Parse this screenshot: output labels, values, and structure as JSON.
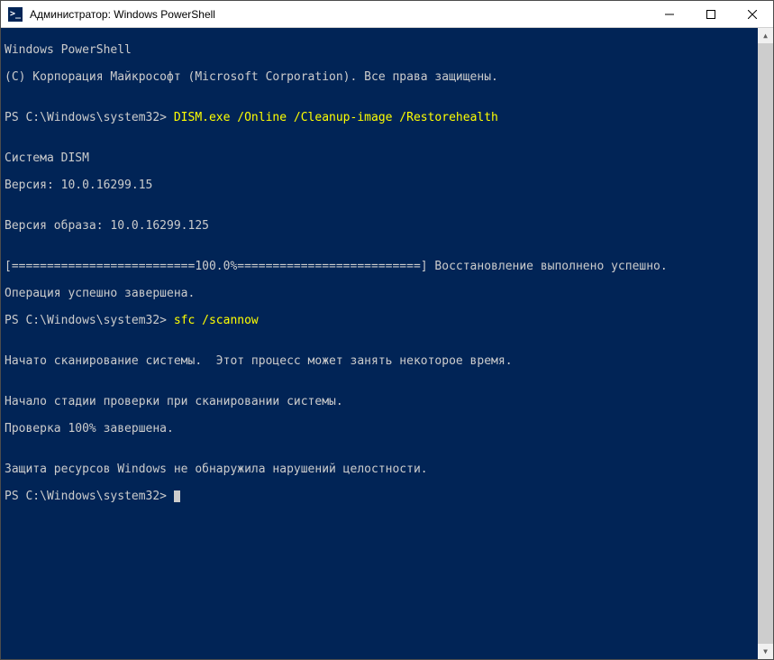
{
  "window": {
    "title": "Администратор: Windows PowerShell",
    "icon_glyph": ">_"
  },
  "terminal": {
    "header1": "Windows PowerShell",
    "header2": "(C) Корпорация Майкрософт (Microsoft Corporation). Все права защищены.",
    "prompt1": "PS C:\\Windows\\system32> ",
    "cmd1": "DISM.exe /Online /Cleanup-image /Restorehealth",
    "blank": "",
    "dism_label": "Система DISM",
    "dism_version": "Версия: 10.0.16299.15",
    "image_version": "Версия образа: 10.0.16299.125",
    "progress": "[==========================100.0%==========================] Восстановление выполнено успешно.",
    "op_done": "Операция успешно завершена.",
    "prompt2": "PS C:\\Windows\\system32> ",
    "cmd2": "sfc /scannow",
    "scan_start": "Начато сканирование системы.  Этот процесс может занять некоторое время.",
    "scan_stage": "Начало стадии проверки при сканировании системы.",
    "scan_pct": "Проверка 100% завершена.",
    "sfc_result": "Защита ресурсов Windows не обнаружила нарушений целостности.",
    "prompt3": "PS C:\\Windows\\system32> "
  }
}
